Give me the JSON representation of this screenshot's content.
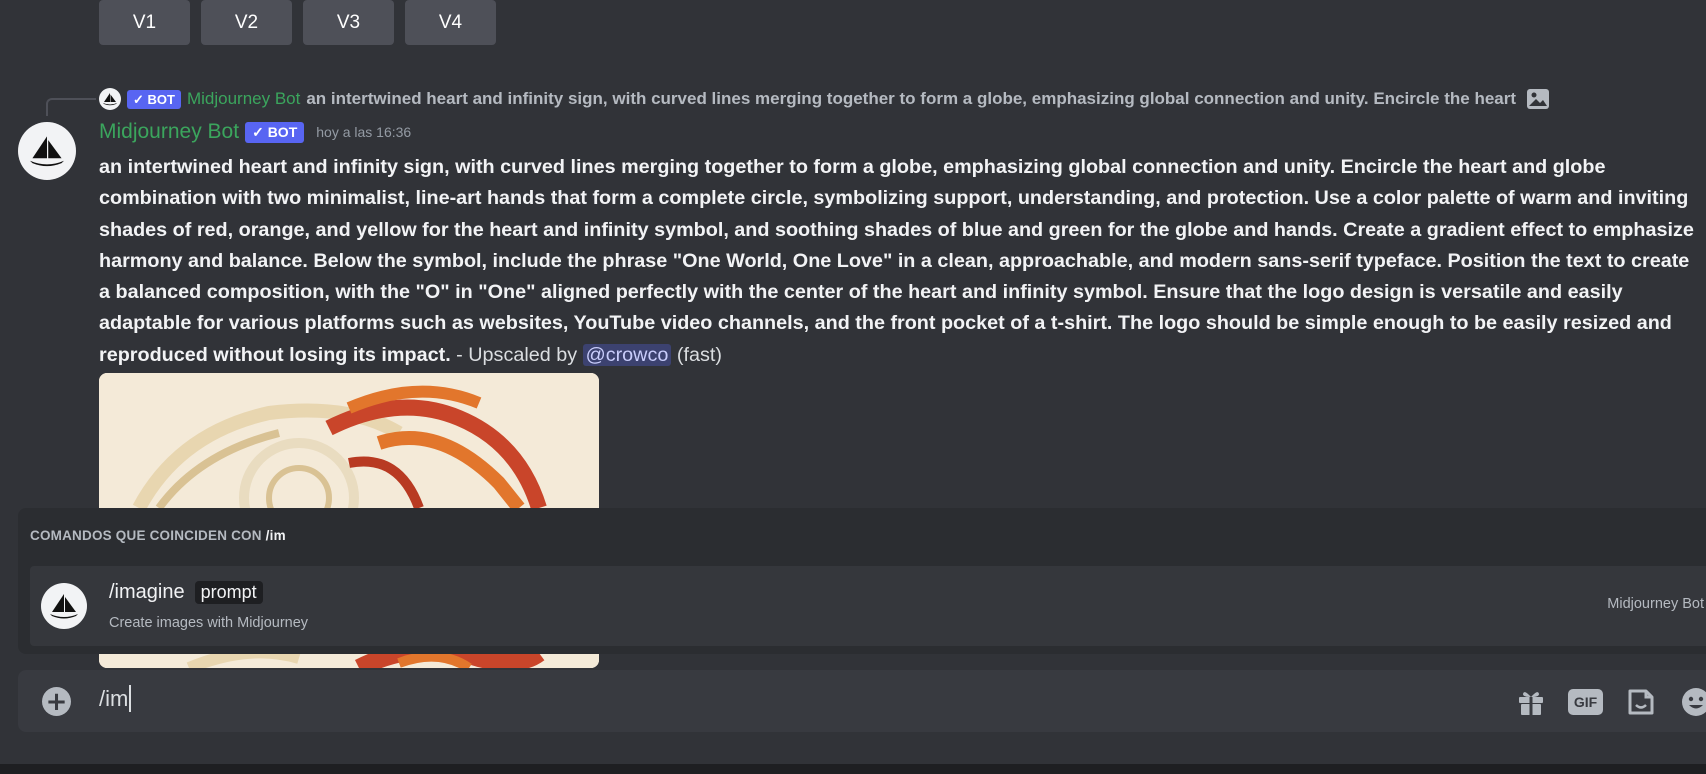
{
  "variation_buttons": [
    {
      "label": "V1"
    },
    {
      "label": "V2"
    },
    {
      "label": "V3"
    },
    {
      "label": "V4"
    }
  ],
  "reply": {
    "bot_tag": "✓ BOT",
    "author": "Midjourney Bot",
    "text": "an intertwined heart and infinity sign, with curved lines merging together to form a globe, emphasizing global connection and unity. Encircle the heart",
    "icon": "image-icon"
  },
  "message": {
    "author": "Midjourney Bot",
    "bot_tag": "✓ BOT",
    "timestamp": "hoy a las 16:36",
    "prompt": "an intertwined heart and infinity sign, with curved lines merging together to form a globe, emphasizing global connection and unity. Encircle the heart and globe combination with two minimalist, line-art hands that form a complete circle, symbolizing support, understanding, and protection. Use a color palette of warm and inviting shades of red, orange, and yellow for the heart and infinity symbol, and soothing shades of blue and green for the globe and hands. Create a gradient effect to emphasize harmony and balance. Below the symbol, include the phrase \"One World, One Love\" in a clean, approachable, and modern sans-serif typeface. Position the text to create a balanced composition, with the \"O\" in \"One\" aligned perfectly with the center of the heart and infinity symbol. Ensure that the logo design is versatile and easily adaptable for various platforms such as websites, YouTube video channels, and the front pocket of a t-shirt. The logo should be simple enough to be easily resized and reproduced without losing its impact.",
    "upscaled_prefix": " - Upscaled by ",
    "mention": "@crowco",
    "suffix": " (fast)"
  },
  "autocomplete": {
    "title": "COMANDOS QUE COINCIDEN CON ",
    "query": "/im",
    "command": {
      "name": "/imagine",
      "param": "prompt",
      "description": "Create images with Midjourney",
      "source": "Midjourney Bot"
    }
  },
  "input": {
    "value": "/im",
    "icons": [
      "gift-icon",
      "gif-icon",
      "sticker-icon",
      "emoji-icon"
    ],
    "gif_label": "GIF"
  },
  "colors": {
    "background": "#313338",
    "bot_tag": "#5865f2",
    "author_green": "#3ba55d",
    "mention_bg": "#3c4270"
  }
}
